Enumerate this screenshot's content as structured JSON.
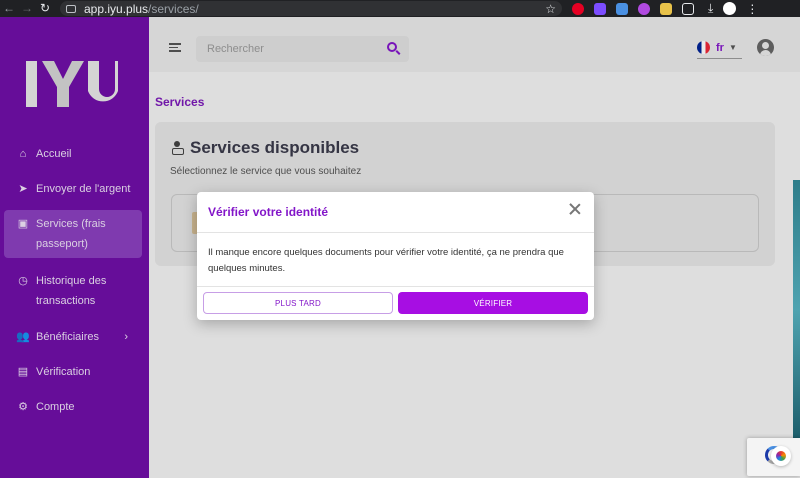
{
  "browser": {
    "url_host": "app.iyu.plus",
    "url_path": "/services/"
  },
  "sidebar": {
    "logo_text": "IYU",
    "items": [
      {
        "label": "Accueil",
        "icon": "home-icon"
      },
      {
        "label": "Envoyer de l'argent",
        "icon": "send-icon"
      },
      {
        "label": "Services (frais passeport)",
        "icon": "briefcase-icon",
        "active": true
      },
      {
        "label": "Historique des transactions",
        "icon": "history-icon"
      },
      {
        "label": "Bénéficiaires",
        "icon": "people-icon",
        "has_submenu": true
      },
      {
        "label": "Vérification",
        "icon": "id-card-icon"
      },
      {
        "label": "Compte",
        "icon": "gear-icon"
      }
    ]
  },
  "header": {
    "search_placeholder": "Rechercher",
    "language_code": "fr"
  },
  "main": {
    "page_title": "Services",
    "card_title": "Services disponibles",
    "card_subtitle": "Sélectionnez le service que vous souhaitez"
  },
  "modal": {
    "title": "Vérifier votre identité",
    "body": "Il manque encore quelques documents pour vérifier votre identité, ça ne prendra que quelques minutes.",
    "later_label": "PLUS TARD",
    "verify_label": "VÉRIFIER"
  },
  "colors": {
    "sidebar": "#6f0fa6",
    "accent": "#8316c9",
    "button_primary": "#a70ee3"
  }
}
